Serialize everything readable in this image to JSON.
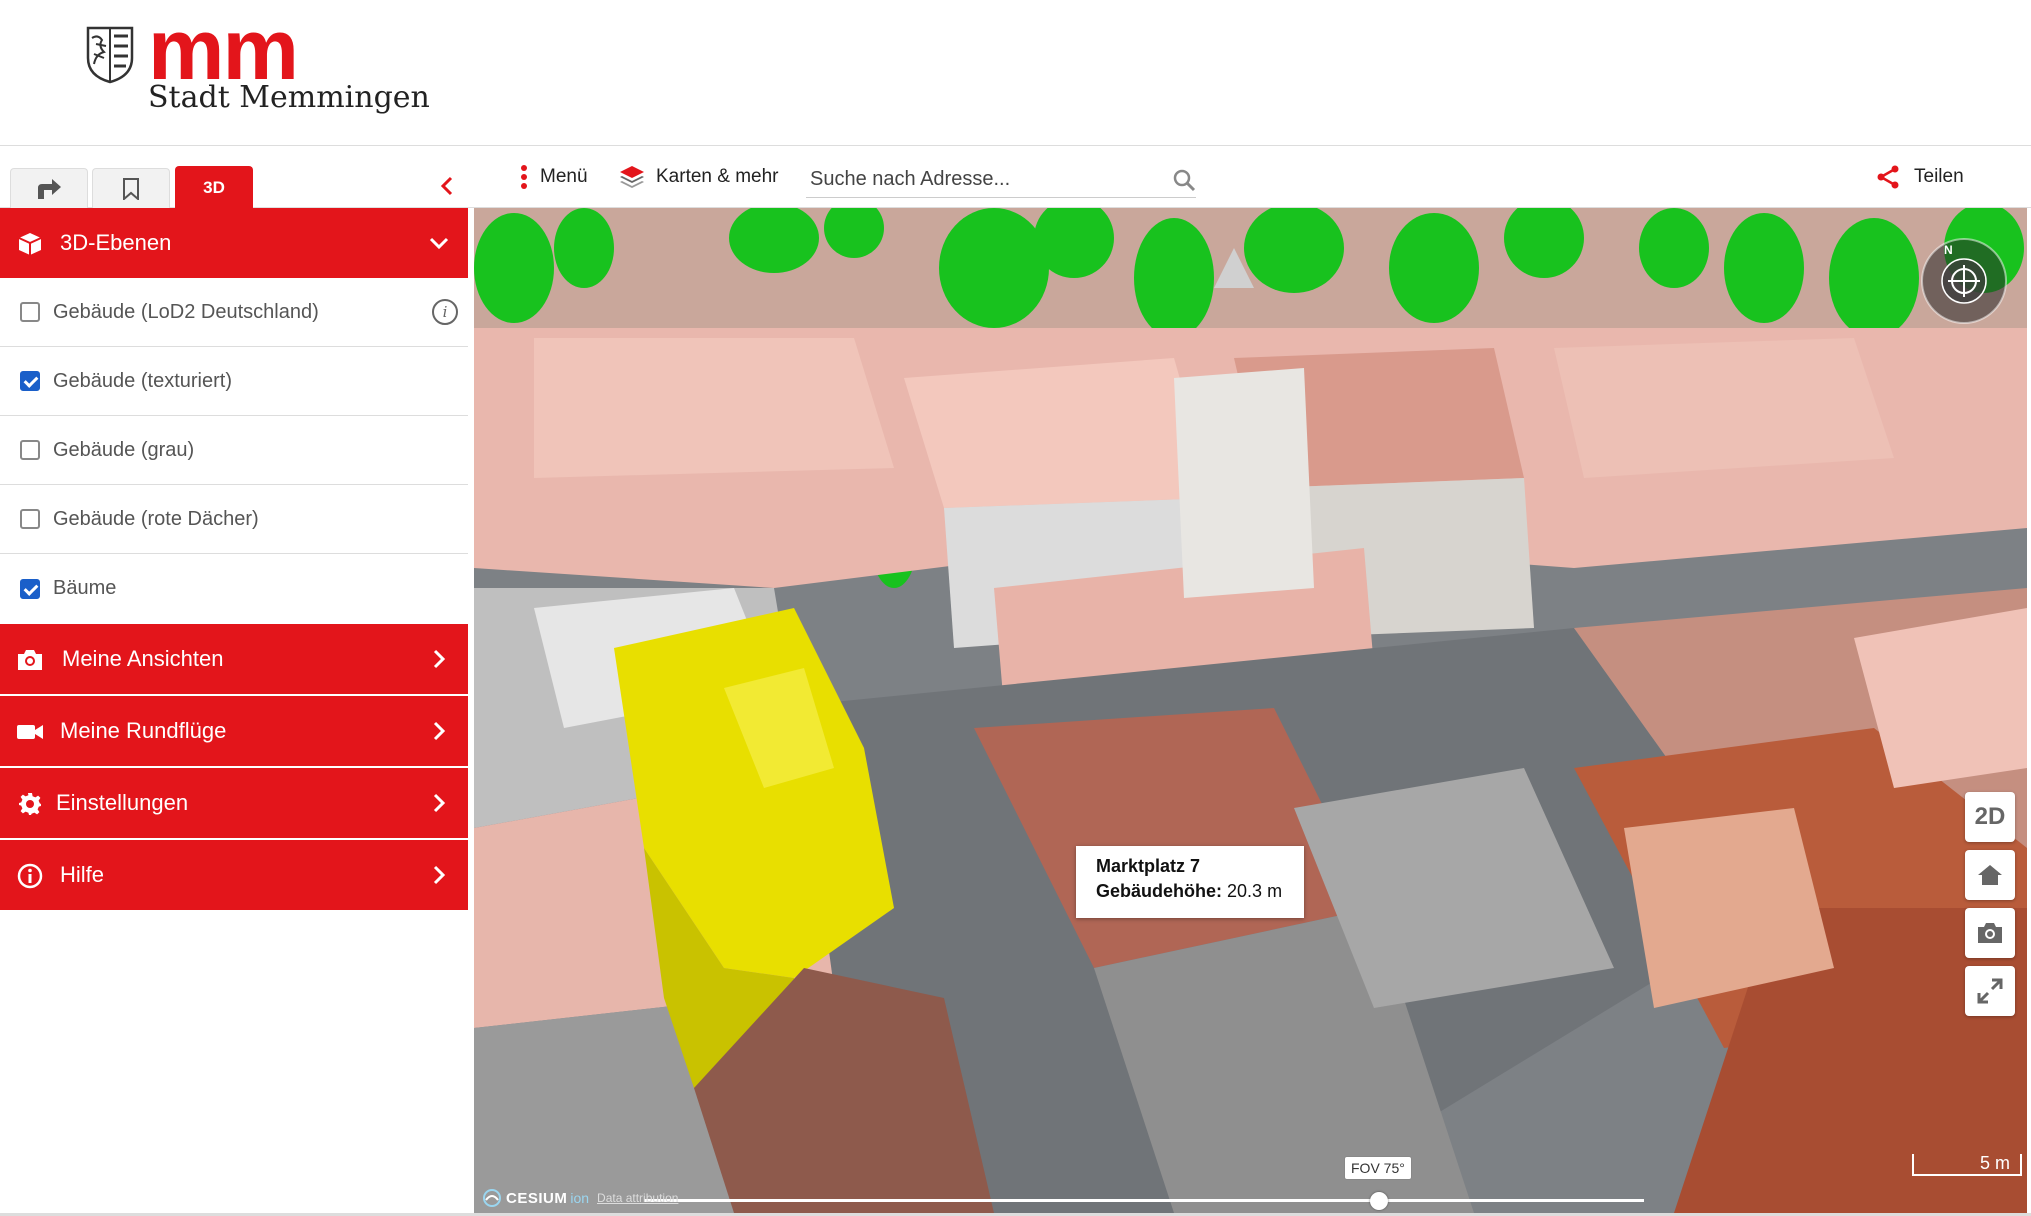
{
  "header": {
    "logo_mark": "mm",
    "city_name": "Stadt Memmingen"
  },
  "sidebar": {
    "tabs": [
      {
        "icon": "share-arrow-icon",
        "label": ""
      },
      {
        "icon": "bookmark-icon",
        "label": ""
      },
      {
        "icon": "",
        "label": "3D"
      }
    ],
    "layers_header": "3D-Ebenen",
    "layers": [
      {
        "label": "Gebäude (LoD2 Deutschland)",
        "checked": false,
        "info": true
      },
      {
        "label": "Gebäude (texturiert)",
        "checked": true,
        "info": false
      },
      {
        "label": "Gebäude (grau)",
        "checked": false,
        "info": false
      },
      {
        "label": "Gebäude (rote Dächer)",
        "checked": false,
        "info": false
      },
      {
        "label": "Bäume",
        "checked": true,
        "info": false
      }
    ],
    "info_glyph": "i",
    "panels": [
      {
        "label": "Meine Ansichten",
        "icon": "camera-icon"
      },
      {
        "label": "Meine Rundflüge",
        "icon": "video-camera-icon"
      },
      {
        "label": "Einstellungen",
        "icon": "gear-icon"
      },
      {
        "label": "Hilfe",
        "icon": "info-icon"
      }
    ]
  },
  "toolbar": {
    "menu_label": "Menü",
    "maps_label": "Karten & mehr",
    "search_placeholder": "Suche nach Adresse...",
    "share_label": "Teilen"
  },
  "map": {
    "tooltip": {
      "address": "Marktplatz 7",
      "height_label": "Gebäudehöhe:",
      "height_value": "20.3 m"
    },
    "compass_label": "N",
    "twod_label": "2D",
    "fov_label": "FOV 75°",
    "fov_value_degrees": 75,
    "scale_label": "5 m",
    "attribution": {
      "cesium": "CESIUM",
      "ion": "ion",
      "data": "Data attribution"
    }
  },
  "colors": {
    "brand_red": "#e3151b",
    "checkbox_blue": "#1a5fc9",
    "highlight_yellow": "#e8e000"
  }
}
